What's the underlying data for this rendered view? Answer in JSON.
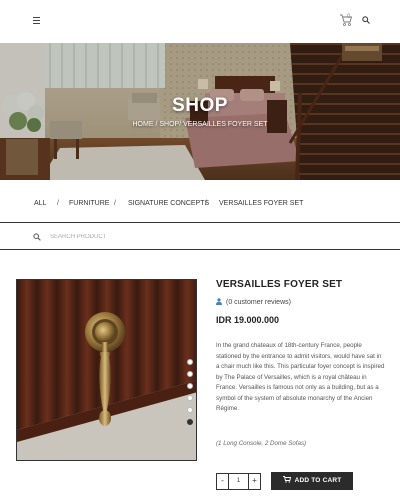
{
  "header": {
    "cart_count": "0",
    "menu_icon": "hamburger-menu-icon",
    "cart_icon": "shopping-cart-icon",
    "search_icon": "search-icon"
  },
  "hero": {
    "title": "SHOP",
    "breadcrumb": [
      "HOME",
      "SHOP",
      "VERSAILLES FOYER SET"
    ],
    "breadcrumb_sep": "/"
  },
  "filters": {
    "items": [
      "ALL",
      "FURNITURE",
      "SIGNATURE CONCEPTS",
      "VERSAILLES FOYER SET"
    ],
    "separator": "/"
  },
  "search": {
    "placeholder": "SEARCH PRODUCT"
  },
  "product": {
    "title": "VERSAILLES FOYER SET",
    "reviews": "(0 customer reviews)",
    "price": "IDR 19.000.000",
    "description": "In the grand chateaux of 18th-century France, people stationed by the entrance to admit visitors, would have sat in a chair much like this. This particular foyer concept is inspired by The Palace of Versailles, which is a royal château in France. Versailles is famous not only as a building, but as a symbol of the system of absolute monarchy of the Ancien Régime.",
    "note": "(1 Long Console, 2 Dome Sofas)",
    "quantity": "1",
    "minus": "-",
    "plus": "+",
    "add_to_cart": "ADD TO CART",
    "gallery_dots": 6,
    "active_dot": 5
  },
  "colors": {
    "dark": "#2b2b2b",
    "border": "#333333",
    "text": "#333333"
  }
}
